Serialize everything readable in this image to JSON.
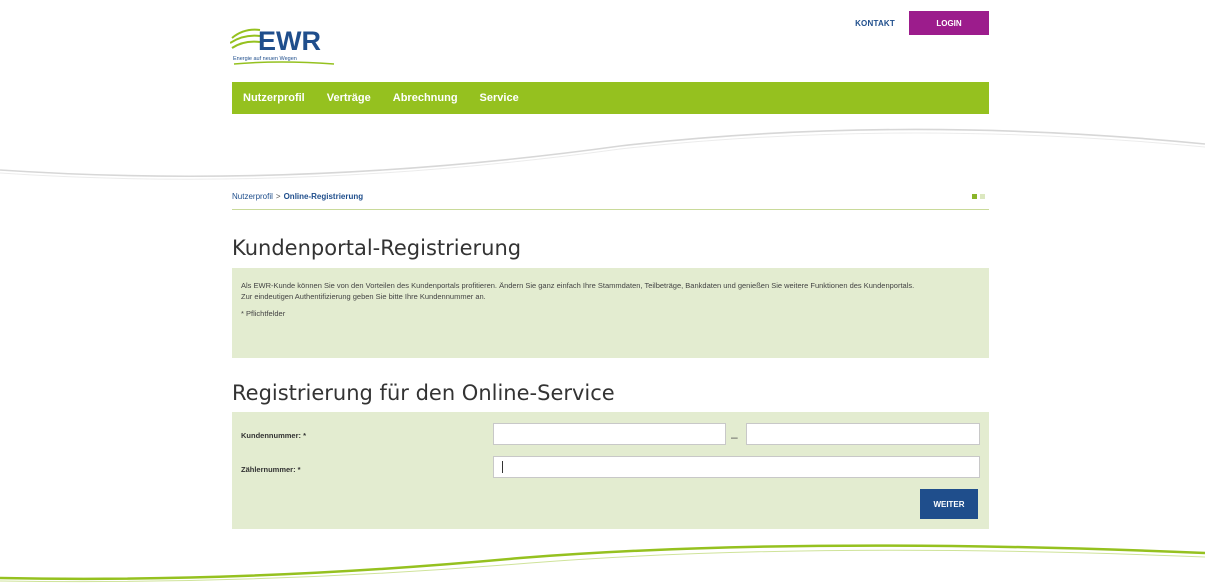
{
  "header": {
    "logo_text": "EWR",
    "logo_tagline": "Energie auf neuen Wegen",
    "kontakt_label": "KONTAKT",
    "login_label": "LOGIN"
  },
  "nav": {
    "items": [
      {
        "label": "Nutzerprofil"
      },
      {
        "label": "Verträge"
      },
      {
        "label": "Abrechnung"
      },
      {
        "label": "Service"
      }
    ]
  },
  "breadcrumb": {
    "root": "Nutzerprofil",
    "separator": ">",
    "current": "Online-Registrierung"
  },
  "page": {
    "title": "Kundenportal-Registrierung",
    "intro_line1": "Als EWR-Kunde können Sie von den Vorteilen des Kundenportals profitieren. Ändern Sie ganz einfach Ihre Stammdaten, Teilbeträge, Bankdaten und genießen Sie weitere Funktionen des Kundenportals.",
    "intro_line2": "Zur eindeutigen Authentifizierung geben Sie bitte Ihre Kundennummer an.",
    "required_note": "* Pflichtfelder",
    "section_title": "Registrierung für den Online-Service"
  },
  "form": {
    "kundennummer_label": "Kundennummer: *",
    "kundennummer_part1": "",
    "kundennummer_part2": "",
    "separator": "–",
    "zaehlernummer_label": "Zählernummer: *",
    "zaehlernummer_value": "",
    "submit_label": "WEITER"
  },
  "colors": {
    "brand_green": "#95c11f",
    "brand_blue": "#1f4e8c",
    "login_purple": "#9c1c8c",
    "panel_bg": "#e3ecd0"
  }
}
